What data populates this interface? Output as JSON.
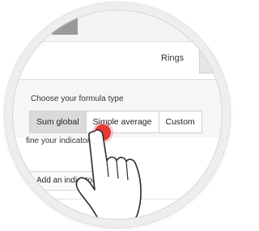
{
  "options": {
    "rings_label": "Rings"
  },
  "formula": {
    "title": "Choose your formula type",
    "options": [
      "Sum global",
      "Simple average",
      "Custom"
    ],
    "selected": "Sum global"
  },
  "indicators": {
    "title": "fine your indicators",
    "add_button": "Add an indicator"
  },
  "colors": {
    "tap_indicator": "#e53935",
    "selected_segment": "#dadada"
  },
  "icons": {
    "rings": "ring-icon",
    "gesture": "pointing-hand-icon"
  }
}
